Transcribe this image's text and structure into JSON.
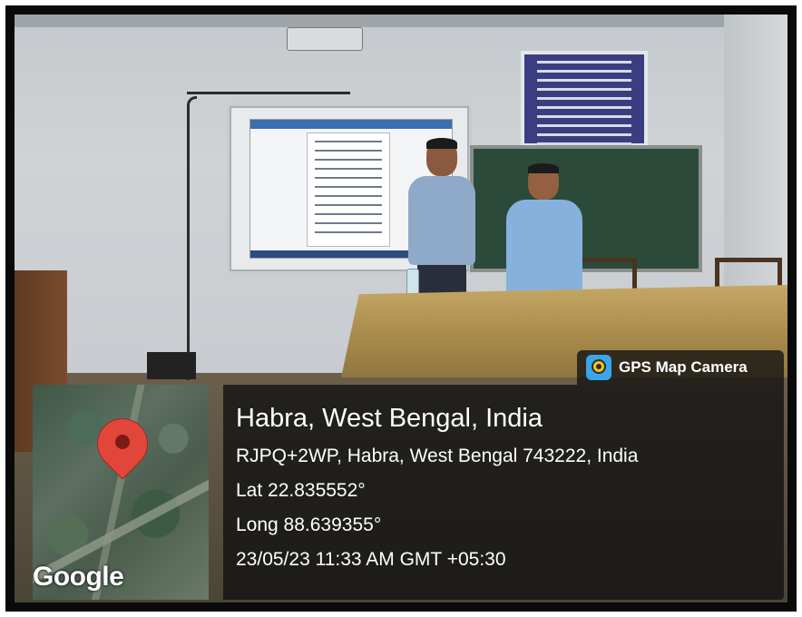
{
  "overlay": {
    "badge_title": "GPS Map Camera",
    "badge_icon": "gps-camera-icon",
    "place": "Habra, West Bengal, India",
    "address": "RJPQ+2WP, Habra, West Bengal 743222, India",
    "latitude": "Lat 22.835552°",
    "longitude": "Long 88.639355°",
    "datetime": "23/05/23 11:33 AM GMT +05:30",
    "map_logo": "Google",
    "pin_icon": "location-pin-icon",
    "pin_color": "#e2463a"
  }
}
